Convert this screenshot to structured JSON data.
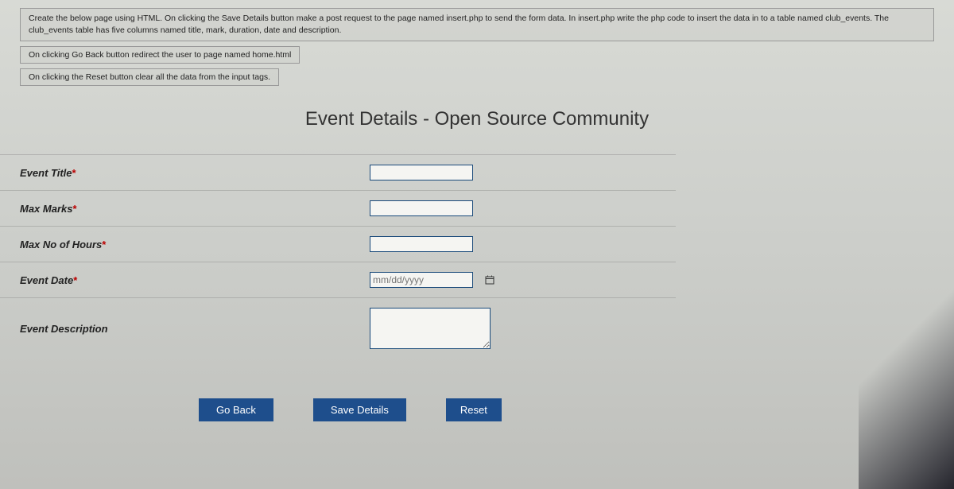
{
  "instructions": {
    "main": "Create the below page using HTML. On clicking the Save Details button make a post request to the page named insert.php to send the form data. In insert.php write the php code to insert the data in to a table named club_events. The club_events table has five columns named title, mark, duration, date and description.",
    "line2": "On clicking Go Back button redirect the user to page named home.html",
    "line3": "On clicking the Reset button clear all the data from the input tags."
  },
  "page_title": "Event Details - Open Source Community",
  "fields": {
    "title": {
      "label": "Event Title",
      "required": "*"
    },
    "marks": {
      "label": "Max Marks",
      "required": "*"
    },
    "hours": {
      "label": "Max No of Hours",
      "required": "*"
    },
    "date": {
      "label": "Event Date",
      "required": "*",
      "placeholder": "mm/dd/yyyy"
    },
    "desc": {
      "label": "Event Description",
      "required": ""
    }
  },
  "buttons": {
    "back": "Go Back",
    "save": "Save Details",
    "reset": "Reset"
  }
}
